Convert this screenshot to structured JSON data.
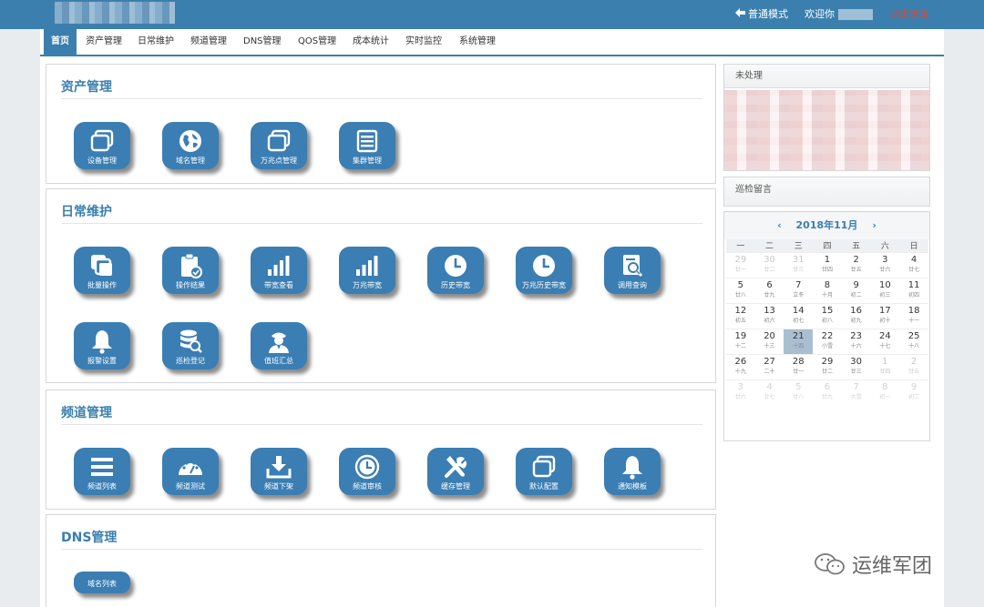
{
  "header": {
    "mode_link": "普通模式",
    "welcome": "欢迎你",
    "logout": "退出登录"
  },
  "nav": {
    "tabs": [
      "首页",
      "资产管理",
      "日常维护",
      "频道管理",
      "DNS管理",
      "QOS管理",
      "成本统计",
      "实时监控",
      "系统管理"
    ],
    "active_index": 0
  },
  "sections": {
    "asset": {
      "title": "资产管理",
      "tiles": [
        {
          "label": "设备管理",
          "icon": "window-stack-icon"
        },
        {
          "label": "域名管理",
          "icon": "globe-icon"
        },
        {
          "label": "万兆点管理",
          "icon": "window-stack-icon"
        },
        {
          "label": "集群管理",
          "icon": "list-panel-icon"
        }
      ]
    },
    "daily": {
      "title": "日常维护",
      "tiles": [
        {
          "label": "批量操作",
          "icon": "copy-stack-icon"
        },
        {
          "label": "操作结果",
          "icon": "clipboard-check-icon"
        },
        {
          "label": "带宽查看",
          "icon": "signal-bars-icon"
        },
        {
          "label": "万兆带宽",
          "icon": "signal-bars-icon"
        },
        {
          "label": "历史带宽",
          "icon": "clock-icon"
        },
        {
          "label": "万兆历史带宽",
          "icon": "clock-icon"
        },
        {
          "label": "调用查询",
          "icon": "document-search-icon"
        },
        {
          "label": "报警设置",
          "icon": "bell-icon"
        },
        {
          "label": "巡检登记",
          "icon": "database-search-icon"
        },
        {
          "label": "值班汇总",
          "icon": "officer-icon"
        }
      ]
    },
    "channel": {
      "title": "频道管理",
      "tiles": [
        {
          "label": "频道列表",
          "icon": "list-lines-icon"
        },
        {
          "label": "频道测试",
          "icon": "gauge-icon"
        },
        {
          "label": "频道下架",
          "icon": "download-tray-icon"
        },
        {
          "label": "频道审核",
          "icon": "clock-icon"
        },
        {
          "label": "缓存管理",
          "icon": "tools-icon"
        },
        {
          "label": "默认配置",
          "icon": "window-stack-icon"
        },
        {
          "label": "通知模板",
          "icon": "bell-icon"
        }
      ]
    },
    "dns": {
      "title": "DNS管理",
      "tiles": [
        {
          "label": "域名列表",
          "icon": ""
        }
      ]
    }
  },
  "sidebar": {
    "pending_title": "未处理",
    "inspection_title": "巡检留言"
  },
  "calendar": {
    "title": "2018年11月",
    "weekdays": [
      "一",
      "二",
      "三",
      "四",
      "五",
      "六",
      "日"
    ],
    "weeks": [
      [
        [
          "29",
          "廿一",
          1
        ],
        [
          "30",
          "廿二",
          1
        ],
        [
          "31",
          "廿三",
          1
        ],
        [
          "1",
          "廿四",
          0
        ],
        [
          "2",
          "廿五",
          0
        ],
        [
          "3",
          "廿六",
          0
        ],
        [
          "4",
          "廿七",
          0
        ]
      ],
      [
        [
          "5",
          "廿八",
          0
        ],
        [
          "6",
          "廿九",
          0
        ],
        [
          "7",
          "立冬",
          0
        ],
        [
          "8",
          "十月",
          0
        ],
        [
          "9",
          "初二",
          0
        ],
        [
          "10",
          "初三",
          0
        ],
        [
          "11",
          "初四",
          0
        ]
      ],
      [
        [
          "12",
          "初五",
          0
        ],
        [
          "13",
          "初六",
          0
        ],
        [
          "14",
          "初七",
          0
        ],
        [
          "15",
          "初八",
          0
        ],
        [
          "16",
          "初九",
          0
        ],
        [
          "17",
          "初十",
          0
        ],
        [
          "18",
          "十一",
          0
        ]
      ],
      [
        [
          "19",
          "十二",
          0
        ],
        [
          "20",
          "十三",
          0
        ],
        [
          "21",
          "十四",
          2
        ],
        [
          "22",
          "小雪",
          0
        ],
        [
          "23",
          "十六",
          0
        ],
        [
          "24",
          "十七",
          0
        ],
        [
          "25",
          "十八",
          0
        ]
      ],
      [
        [
          "26",
          "十九",
          0
        ],
        [
          "27",
          "二十",
          0
        ],
        [
          "28",
          "廿一",
          0
        ],
        [
          "29",
          "廿二",
          0
        ],
        [
          "30",
          "廿三",
          0
        ],
        [
          "1",
          "廿四",
          1
        ],
        [
          "2",
          "廿五",
          1
        ]
      ],
      [
        [
          "3",
          "廿六",
          3
        ],
        [
          "4",
          "廿七",
          3
        ],
        [
          "5",
          "廿八",
          3
        ],
        [
          "6",
          "廿九",
          3
        ],
        [
          "7",
          "大雪",
          3
        ],
        [
          "8",
          "初一",
          3
        ],
        [
          "9",
          "初二",
          3
        ]
      ]
    ]
  },
  "watermark": {
    "text": "运维军团"
  }
}
